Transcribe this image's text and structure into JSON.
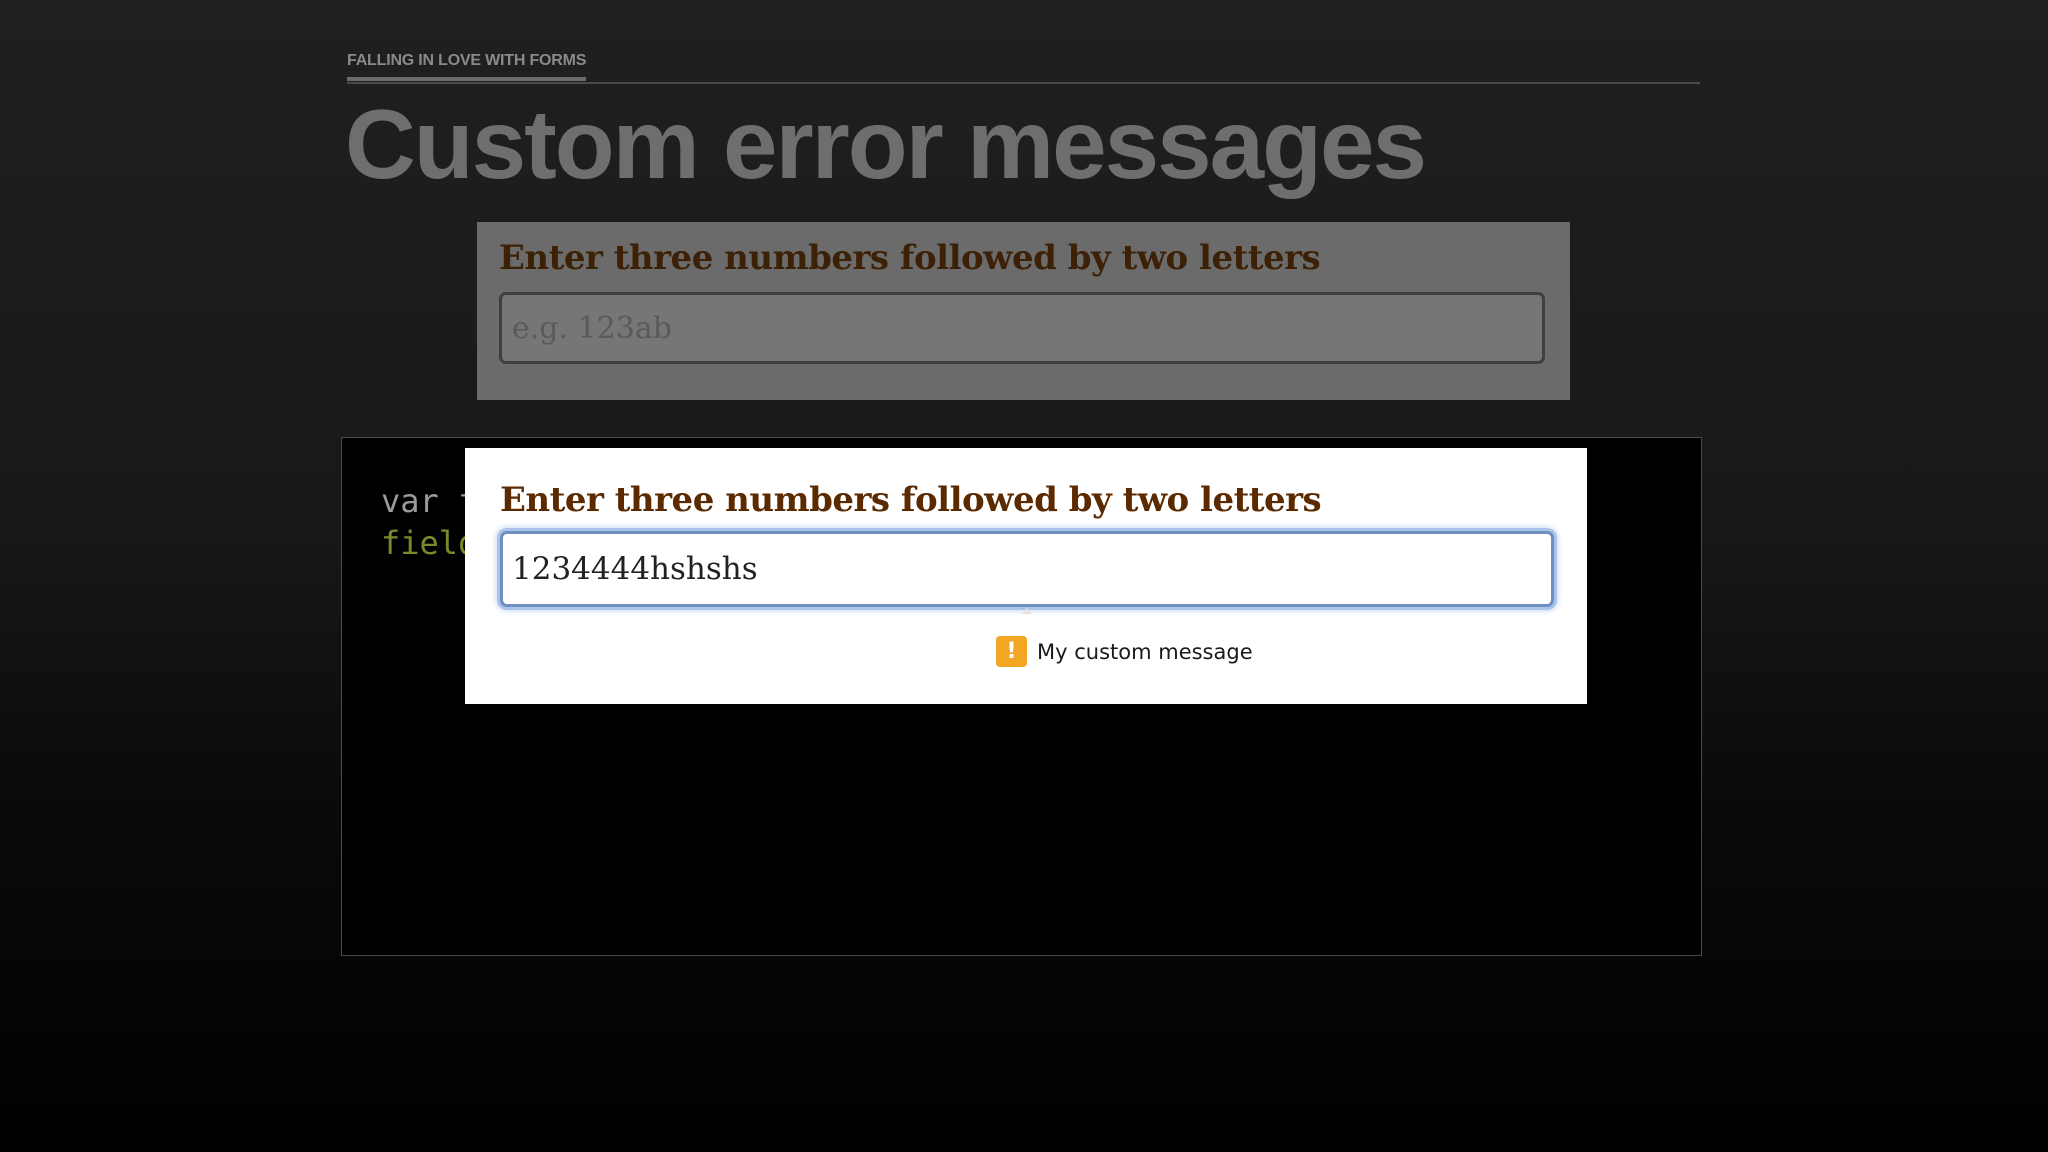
{
  "slide": {
    "eyebrow": "FALLING IN LOVE WITH FORMS",
    "title": "Custom error messages"
  },
  "background_form": {
    "label": "Enter three numbers followed by two letters",
    "placeholder": "e.g. 123ab"
  },
  "code": {
    "line1": "var f",
    "line2": "field"
  },
  "demo_form": {
    "label": "Enter three numbers followed by two letters",
    "value": "1234444hshshs"
  },
  "validation": {
    "icon": "warning-icon",
    "message": "My custom message"
  },
  "colors": {
    "label_brown": "#5b2a00",
    "focus_blue": "#6f8fbf",
    "warning_orange": "#f2a623"
  }
}
